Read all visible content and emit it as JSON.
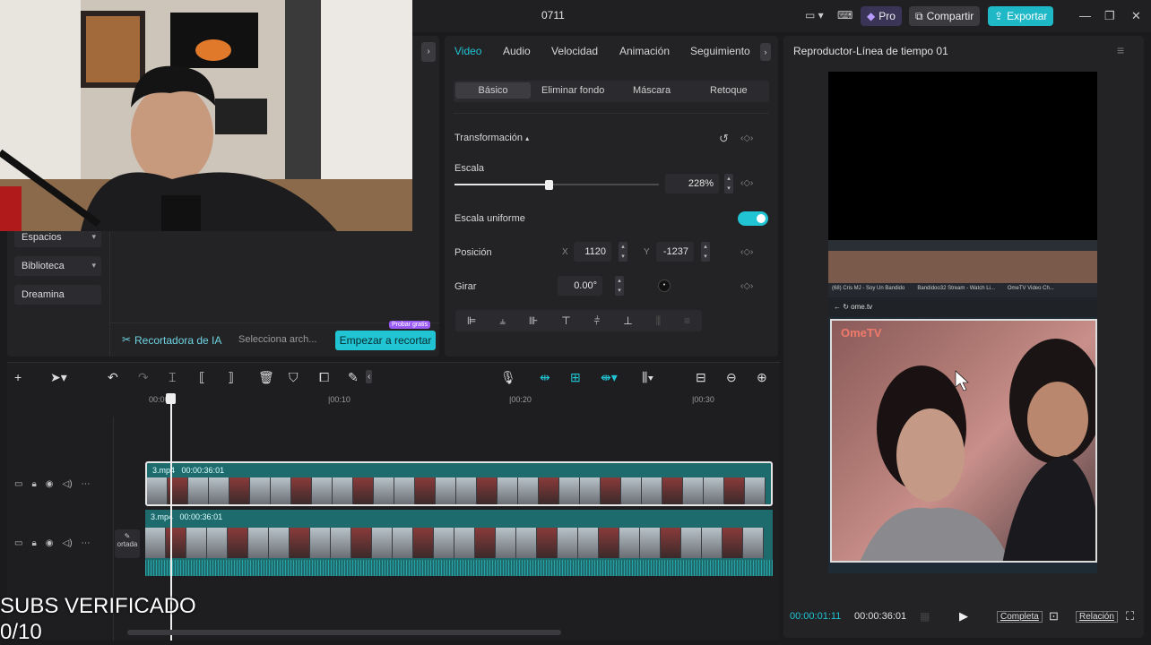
{
  "window": {
    "title": "0711"
  },
  "topbar": {
    "pro_label": "Pro",
    "share_label": "Compartir",
    "export_label": "Exportar"
  },
  "sidebar": {
    "items": [
      {
        "label": "Espacios",
        "has_chevron": true
      },
      {
        "label": "Biblioteca",
        "has_chevron": true
      },
      {
        "label": "Dreamina",
        "has_chevron": false
      }
    ]
  },
  "ai_cutter": {
    "label": "Recortadora de IA",
    "select_placeholder": "Selecciona arch...",
    "button_label": "Empezar a recortar",
    "badge": "Probar gratis"
  },
  "properties": {
    "tabs": [
      "Video",
      "Audio",
      "Velocidad",
      "Animación",
      "Seguimiento"
    ],
    "active_tab": "Video",
    "subtabs": [
      "Básico",
      "Eliminar fondo",
      "Máscara",
      "Retoque"
    ],
    "active_subtab": "Básico",
    "section_title": "Transformación",
    "scale_label": "Escala",
    "scale_value": "228%",
    "scale_fraction": 0.46,
    "uniform_scale_label": "Escala uniforme",
    "uniform_scale_on": true,
    "position_label": "Posición",
    "pos_x_label": "X",
    "pos_x_value": "1120",
    "pos_y_label": "Y",
    "pos_y_value": "-1237",
    "rotate_label": "Girar",
    "rotate_value": "0.00°"
  },
  "player": {
    "title": "Reproductor-Línea de tiempo 01",
    "current_time": "00:00:01:11",
    "total_time": "00:00:36:01",
    "full_label": "Completa",
    "ratio_label": "Relación",
    "browser_tabs": [
      "(68) Cris MJ - Soy Un Bandido",
      "Bandidoo32 Stream - Watch Li...",
      "OmeTV Video Ch..."
    ],
    "address": "ome.tv",
    "site_logo": "OmeTV"
  },
  "timeline": {
    "ticks": [
      "00:00",
      "|00:10",
      "|00:20",
      "|00:30"
    ],
    "clips": [
      {
        "name": "3.mp4",
        "duration": "00:00:36:01"
      },
      {
        "name": "3.mp4",
        "duration": "00:00:36:01"
      }
    ],
    "cover_label": "ortada"
  },
  "overlay": {
    "line1": "SUBS VERIFICADO",
    "line2": "0/10"
  },
  "colors": {
    "accent": "#20c4d3",
    "export": "#1fb8c7",
    "clip": "#1e6b6e"
  }
}
